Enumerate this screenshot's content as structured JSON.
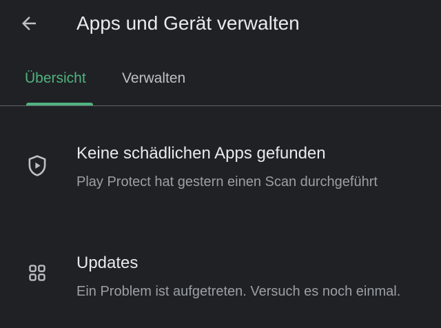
{
  "header": {
    "back_icon": "arrow-back-icon",
    "title": "Apps und Gerät verwalten"
  },
  "tabs": [
    {
      "label": "Übersicht",
      "selected": true
    },
    {
      "label": "Verwalten",
      "selected": false
    }
  ],
  "colors": {
    "background": "#202124",
    "accent": "#4fb381",
    "primary_text": "#e8eaed",
    "secondary_text": "#9aa0a6",
    "icon": "#bdc1c6"
  },
  "items": [
    {
      "icon": "shield-icon",
      "title": "Keine schädlichen Apps gefunden",
      "subtitle": "Play Protect hat gestern einen Scan durchgeführt"
    },
    {
      "icon": "apps-grid-icon",
      "title": "Updates",
      "subtitle": "Ein Problem ist aufgetreten. Versuch es noch einmal."
    }
  ]
}
